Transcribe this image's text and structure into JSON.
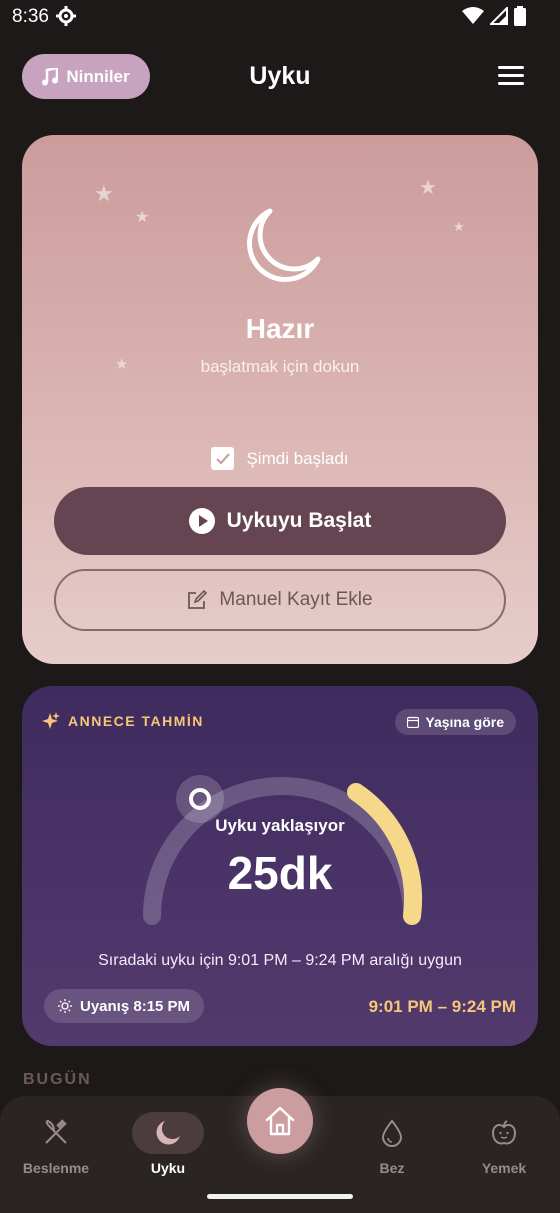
{
  "status_bar": {
    "time": "8:36"
  },
  "header": {
    "lullaby_button": "Ninniler",
    "title": "Uyku"
  },
  "sleep_card": {
    "status_title": "Hazır",
    "status_subtitle": "başlatmak için dokun",
    "started_now_label": "Şimdi başladı",
    "started_now_checked": true,
    "start_button": "Uykuyu Başlat",
    "manual_button": "Manuel Kayıt Ekle"
  },
  "prediction_card": {
    "title": "ANNECE TAHMİN",
    "age_badge": "Yaşına göre",
    "approach_label": "Uyku yaklaşıyor",
    "approach_value": "25dk",
    "range_text": "Sıradaki uyku için 9:01 PM – 9:24 PM aralığı uygun",
    "wake_label": "Uyanış 8:15 PM",
    "range_time": "9:01 PM – 9:24 PM",
    "accent_color": "#f6c77a"
  },
  "today_label": "BUGÜN",
  "bottom_nav": {
    "items": [
      {
        "label": "Beslenme",
        "icon": "fork-knife-icon"
      },
      {
        "label": "Uyku",
        "icon": "moon-icon"
      },
      {
        "label": "Bez",
        "icon": "drop-icon"
      },
      {
        "label": "Yemek",
        "icon": "apple-icon"
      }
    ],
    "active": "Uyku",
    "home_icon": "home-icon"
  }
}
